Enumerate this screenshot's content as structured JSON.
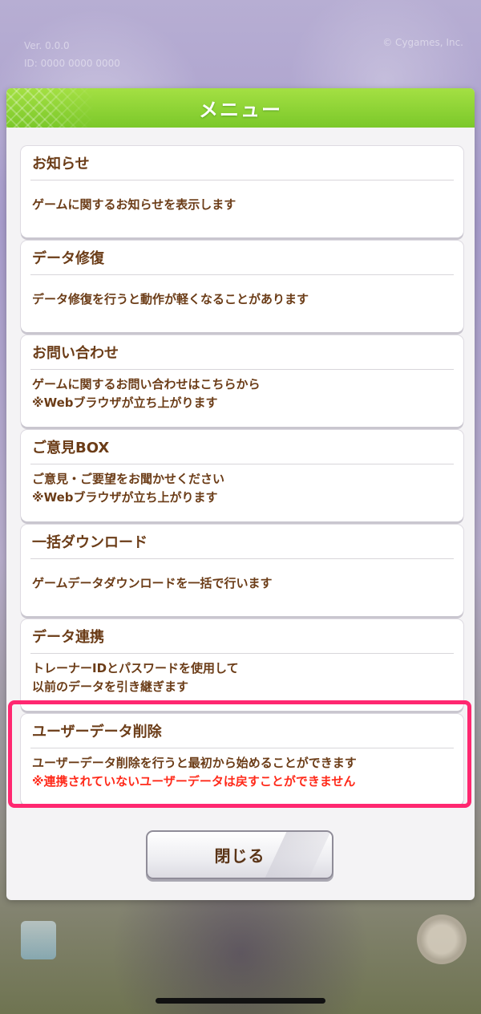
{
  "background": {
    "version_line": "Ver. 0.0.0",
    "id_line": "ID: 0000 0000 0000",
    "copyright": "© Cygames, Inc."
  },
  "dialog": {
    "title": "メニュー",
    "items": [
      {
        "title": "お知らせ",
        "desc": [
          "ゲームに関するお知らせを表示します"
        ]
      },
      {
        "title": "データ修復",
        "desc": [
          "データ修復を行うと動作が軽くなることがあります"
        ]
      },
      {
        "title": "お問い合わせ",
        "desc": [
          "ゲームに関するお問い合わせはこちらから",
          "※Webブラウザが立ち上がります"
        ]
      },
      {
        "title": "ご意見BOX",
        "desc": [
          "ご意見・ご要望をお聞かせください",
          "※Webブラウザが立ち上がります"
        ]
      },
      {
        "title": "一括ダウンロード",
        "desc": [
          "ゲームデータダウンロードを一括で行います"
        ]
      },
      {
        "title": "データ連携",
        "desc": [
          "トレーナーIDとパスワードを使用して",
          "以前のデータを引き継ぎます"
        ]
      },
      {
        "title": "ユーザーデータ削除",
        "desc": [
          "ユーザーデータ削除を行うと最初から始めることができます"
        ],
        "warning": "※連携されていないユーザーデータは戻すことができません"
      }
    ],
    "close_label": "閉じる"
  },
  "colors": {
    "header_green": "#8fd435",
    "text_brown": "#6b3c17",
    "warning_red": "#ff2a1a",
    "highlight_pink": "#ff2770"
  }
}
